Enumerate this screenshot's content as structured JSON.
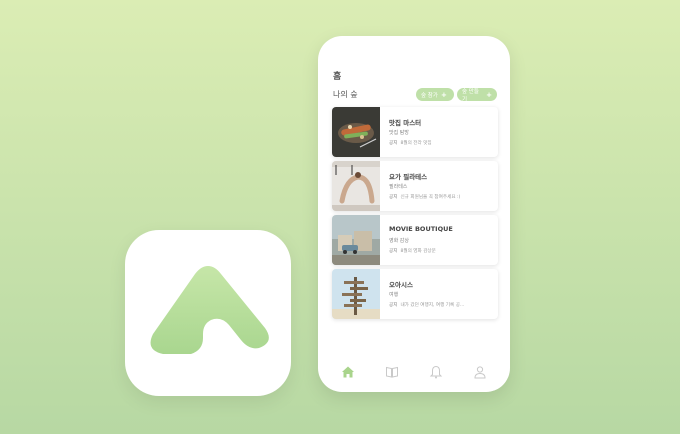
{
  "colors": {
    "accent": "#a9d48c",
    "background_top": "#dbedb4",
    "background_bottom": "#b7d8a3"
  },
  "phone": {
    "title": "홈",
    "section_title": "나의 숲",
    "chips": [
      {
        "label": "숲 참가"
      },
      {
        "label": "숲 만들기"
      }
    ],
    "forests": [
      {
        "name": "맛집 마스터",
        "category": "맛집 탐방",
        "notice_label": "공지",
        "notice": "8월의 전라 맛집",
        "thumb": "food"
      },
      {
        "name": "요가 필라테스",
        "category": "필라테스",
        "notice_label": "공지",
        "notice": "신규 회원님을 꼭 참여주세요 :)",
        "thumb": "yoga"
      },
      {
        "name": "MOVIE BOUTIQUE",
        "category": "영화 감상",
        "notice_label": "공지",
        "notice": "8월의 영화 감상문",
        "thumb": "city"
      },
      {
        "name": "오아시스",
        "category": "여행",
        "notice_label": "공지",
        "notice": "내가 갔던 여행지, 여행 기록 공...",
        "thumb": "signpost"
      }
    ],
    "tabs": [
      {
        "icon": "home-icon"
      },
      {
        "icon": "book-icon"
      },
      {
        "icon": "bell-icon"
      },
      {
        "icon": "user-icon"
      }
    ]
  }
}
